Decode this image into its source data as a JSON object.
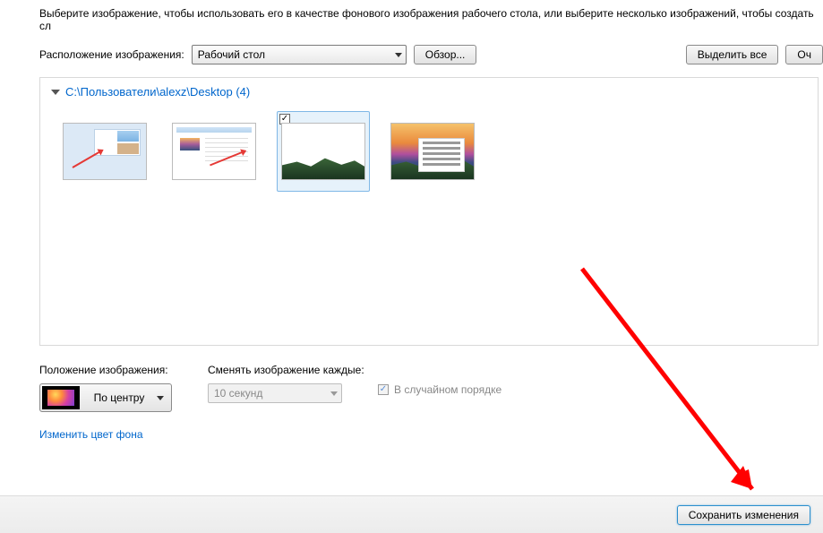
{
  "description": "Выберите изображение, чтобы использовать его в качестве фонового изображения рабочего стола, или выберите несколько изображений, чтобы создать сл",
  "location": {
    "label": "Расположение изображения:",
    "selected": "Рабочий стол",
    "browse": "Обзор...",
    "select_all": "Выделить все",
    "clear": "Оч"
  },
  "folder": {
    "path": "C:\\Пользователи\\alexz\\Desktop (4)"
  },
  "position": {
    "label": "Положение изображения:",
    "selected": "По центру"
  },
  "interval": {
    "label": "Сменять изображение каждые:",
    "selected": "10 секунд"
  },
  "shuffle": {
    "label": "В случайном порядке",
    "checked": "✓"
  },
  "link_color": "Изменить цвет фона",
  "footer": {
    "save": "Сохранить изменения"
  },
  "thumb_check": "✓"
}
